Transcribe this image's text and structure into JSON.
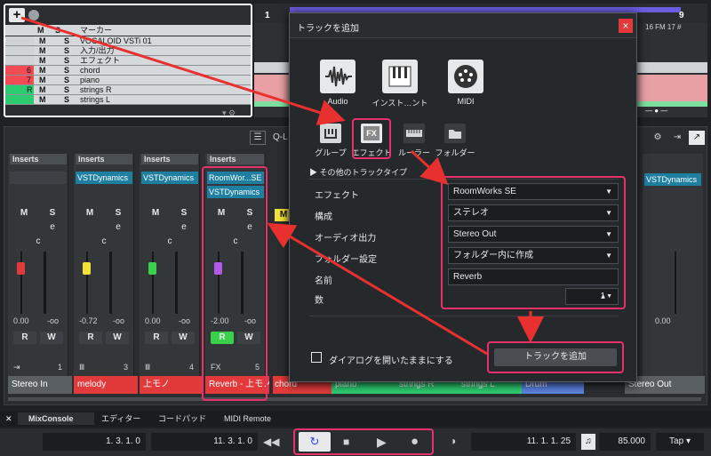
{
  "track_list": {
    "add_btn": "+",
    "header_num": "1",
    "header_name": "マーカー",
    "rows": [
      {
        "name": "VOCALOID VSTi 01",
        "color": "#d0d3d6",
        "num": ""
      },
      {
        "name": "入力/出力",
        "color": "#d0d3d6",
        "num": ""
      },
      {
        "name": "エフェクト",
        "color": "#d0d3d6",
        "num": ""
      },
      {
        "name": "chord",
        "color": "#f24b54",
        "num": "6"
      },
      {
        "name": "piano",
        "color": "#f24b54",
        "num": "7"
      },
      {
        "name": "strings R",
        "color": "#2ecc71",
        "num": "R"
      },
      {
        "name": "strings L",
        "color": "#2ecc71",
        "num": ""
      }
    ],
    "m": "M",
    "s": "S"
  },
  "arrange": {
    "bar1": "1",
    "bar9": "9",
    "bar_label": "16 FM 17 #"
  },
  "dialog": {
    "title": "トラックを追加",
    "close": "×",
    "types": [
      {
        "label": "Audio"
      },
      {
        "label": "インスト…ント"
      },
      {
        "label": "MIDI"
      }
    ],
    "subtypes": [
      {
        "label": "グループ"
      },
      {
        "label": "エフェクト"
      },
      {
        "label": "ルーラー"
      },
      {
        "label": "フォルダー"
      }
    ],
    "other_types": "その他のトラックタイプ",
    "fx_badge": "FX",
    "fields": [
      {
        "label": "エフェクト",
        "value": "RoomWorks SE",
        "type": "select"
      },
      {
        "label": "構成",
        "value": "ステレオ",
        "type": "select"
      },
      {
        "label": "オーディオ出力",
        "value": "Stereo Out",
        "type": "select"
      },
      {
        "label": "フォルダー設定",
        "value": "フォルダー内に作成",
        "type": "select"
      },
      {
        "label": "名前",
        "value": "Reverb",
        "type": "text"
      },
      {
        "label": "数",
        "value": "1",
        "type": "spin"
      }
    ],
    "keep_open": "ダイアログを開いたままにする",
    "add_button": "トラックを追加"
  },
  "mixer": {
    "top_btn": "Q-L",
    "strips": [
      {
        "inserts": "Inserts",
        "slot1": "",
        "slot2": "",
        "vol": "0.00",
        "pan": "-oo",
        "name": "Stereo In",
        "name_color": "#5a5f64",
        "num": "1",
        "fader": "#e23a3a",
        "icon": "⇥"
      },
      {
        "inserts": "Inserts",
        "slot1": "VSTDynamics",
        "slot2": "",
        "vol": "-0.72",
        "pan": "-oo",
        "name": "melody",
        "name_color": "#e23a3a",
        "num": "3",
        "fader": "#f2e13a",
        "icon": "Ⅲ"
      },
      {
        "inserts": "Inserts",
        "slot1": "VSTDynamics",
        "slot2": "",
        "vol": "0.00",
        "pan": "-oo",
        "name": "上モノ",
        "name_color": "#e23a3a",
        "num": "4",
        "fader": "#3ad14a",
        "icon": "Ⅲ"
      },
      {
        "inserts": "Inserts",
        "slot1": "RoomWor...SE",
        "slot2": "VSTDynamics",
        "vol": "-2.00",
        "pan": "-oo",
        "name": "Reverb - 上モノ",
        "name_color": "#e23a3a",
        "num": "5",
        "fader": "#b25ae8",
        "icon": "FX"
      }
    ],
    "right_strip": {
      "slot1": "VSTDynamics",
      "name": "Stereo Out",
      "vol": "0.00"
    },
    "m": "M",
    "s": "S",
    "e": "e",
    "c": "c",
    "r": "R",
    "w": "W",
    "partial_names": [
      "chord",
      "piano",
      "strings R",
      "strings L",
      "Drum"
    ]
  },
  "tabs": {
    "mixconsole": "MixConsole",
    "editor": "エディター",
    "chordpad": "コードパッド",
    "midiremote": "MIDI Remote"
  },
  "transport": {
    "pos1": "1. 3. 1.  0",
    "pos2": "11. 3. 1.  0",
    "pos3": "11. 1. 1. 25",
    "tempo": "85.000",
    "tap": "Tap"
  }
}
